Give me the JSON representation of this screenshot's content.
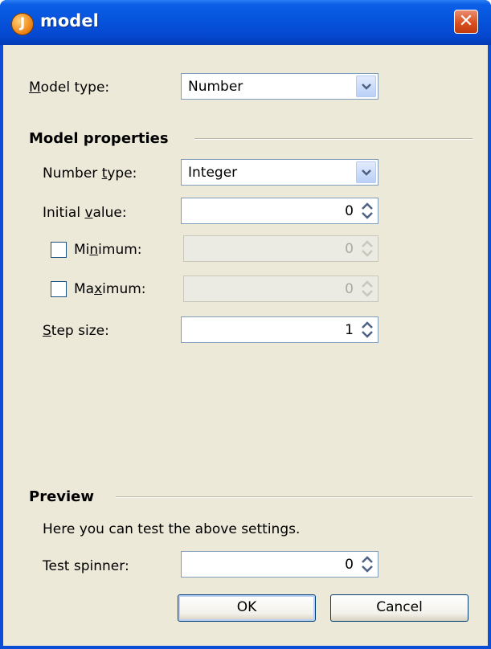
{
  "window": {
    "title": "model",
    "app_icon": "java-icon",
    "close_icon": "close-icon"
  },
  "model_type": {
    "label_pre": "",
    "label_mnemonic": "M",
    "label_post": "odel type:",
    "value": "Number"
  },
  "model_properties": {
    "heading": "Model properties",
    "number_type": {
      "label_pre": "Number ",
      "label_mnemonic": "t",
      "label_post": "ype:",
      "value": "Integer"
    },
    "initial_value": {
      "label_pre": "Initial ",
      "label_mnemonic": "v",
      "label_post": "alue:",
      "value": "0"
    },
    "minimum": {
      "label_pre": "Mi",
      "label_mnemonic": "n",
      "label_post": "imum:",
      "value": "0",
      "checked": false,
      "enabled": false
    },
    "maximum": {
      "label_pre": "Ma",
      "label_mnemonic": "x",
      "label_post": "imum:",
      "value": "0",
      "checked": false,
      "enabled": false
    },
    "step_size": {
      "label_pre": "",
      "label_mnemonic": "S",
      "label_post": "tep size:",
      "value": "1"
    }
  },
  "preview": {
    "heading": "Preview",
    "description": "Here you can test the above settings.",
    "test_spinner": {
      "label": "Test spinner:",
      "value": "0"
    }
  },
  "buttons": {
    "ok": "OK",
    "cancel": "Cancel"
  },
  "colors": {
    "titlebar": "#0753dc",
    "dialog_bg": "#ece9d8",
    "close_button": "#d9501f"
  }
}
